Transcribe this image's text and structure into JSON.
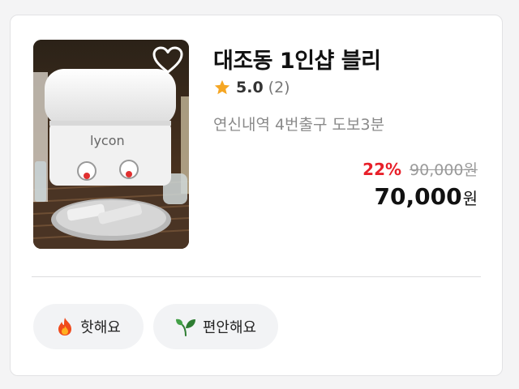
{
  "listing": {
    "title": "대조동 1인샵 블리",
    "rating": "5.0",
    "review_count": "(2)",
    "location": "연신내역 4번출구 도보3분",
    "discount": "22%",
    "original_price": "90,000원",
    "price": "70,000",
    "currency": "원",
    "image_brand_text": "lycon"
  },
  "tags": [
    {
      "label": "핫해요",
      "icon": "fire-icon"
    },
    {
      "label": "편안해요",
      "icon": "sprout-icon"
    }
  ],
  "colors": {
    "discount": "#e8202a",
    "star": "#f5a623",
    "tag_bg": "#f2f3f5"
  }
}
